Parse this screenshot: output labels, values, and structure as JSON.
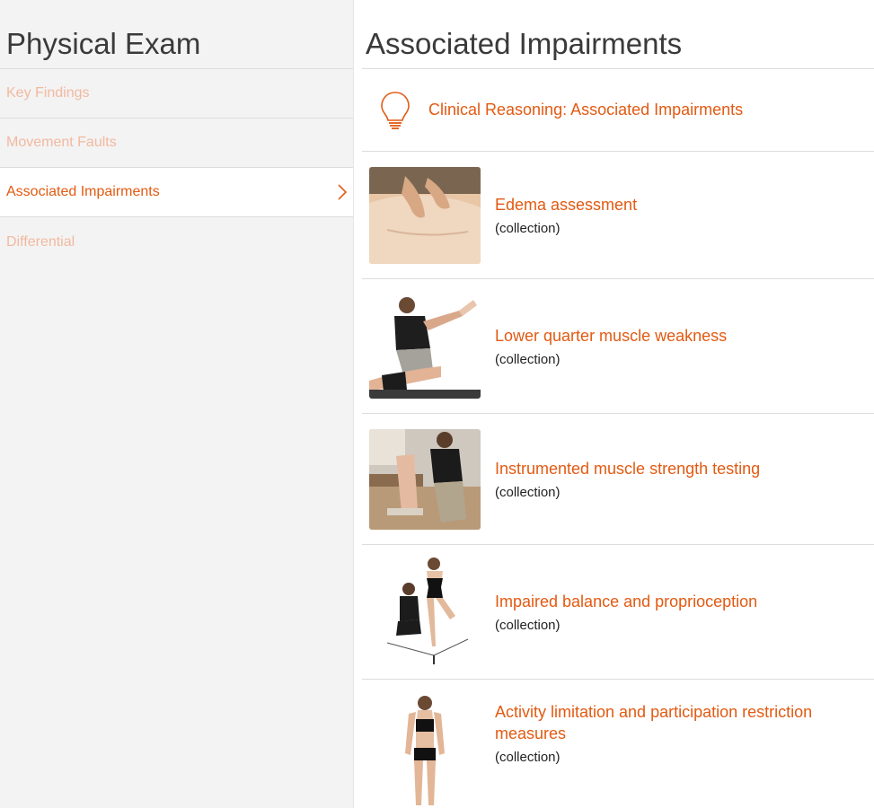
{
  "sidebar": {
    "title": "Physical Exam",
    "items": [
      {
        "label": "Key Findings"
      },
      {
        "label": "Movement Faults"
      },
      {
        "label": "Associated Impairments"
      },
      {
        "label": "Differential"
      }
    ],
    "active_index": 2
  },
  "main": {
    "title": "Associated Impairments",
    "reasoning": {
      "label": "Clinical Reasoning: Associated Impairments",
      "icon": "lightbulb-icon"
    },
    "collections": [
      {
        "title": "Edema assessment",
        "subtitle": "(collection)"
      },
      {
        "title": "Lower quarter muscle weakness",
        "subtitle": "(collection)"
      },
      {
        "title": "Instrumented muscle strength testing",
        "subtitle": "(collection)"
      },
      {
        "title": "Impaired balance and proprioception",
        "subtitle": "(collection)"
      },
      {
        "title": "Activity limitation and participation restriction measures",
        "subtitle": "(collection)"
      }
    ]
  },
  "colors": {
    "accent": "#e25a12",
    "inactive_nav": "#f2b9a0",
    "sidebar_bg": "#f3f3f3",
    "divider": "#dcdcdc"
  }
}
